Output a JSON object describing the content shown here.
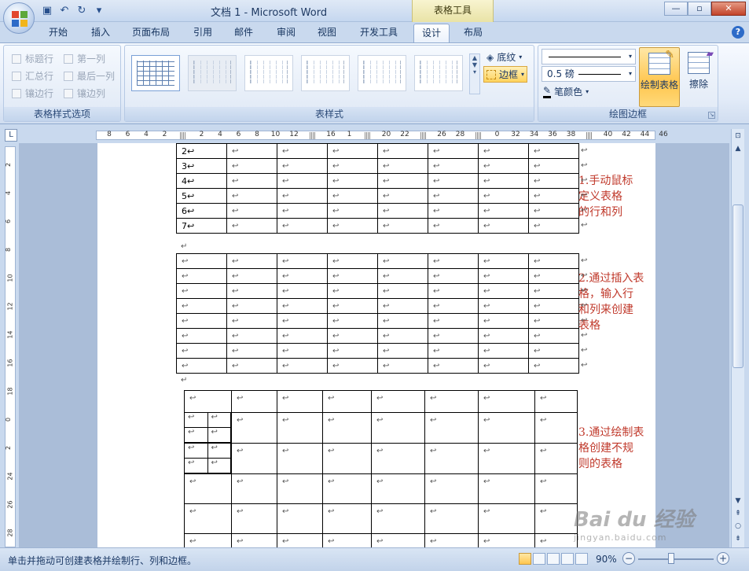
{
  "window": {
    "title": "文档 1 - Microsoft Word",
    "context_tab_title": "表格工具",
    "min": "—",
    "restore": "▫",
    "close": "✕"
  },
  "qat": {
    "save": "save-icon",
    "undo": "↶",
    "redo": "↻",
    "customize": "▾"
  },
  "tabs": [
    {
      "label": "开始"
    },
    {
      "label": "插入"
    },
    {
      "label": "页面布局"
    },
    {
      "label": "引用"
    },
    {
      "label": "邮件"
    },
    {
      "label": "审阅"
    },
    {
      "label": "视图"
    },
    {
      "label": "开发工具"
    },
    {
      "label": "设计"
    },
    {
      "label": "布局"
    }
  ],
  "active_tab": "设计",
  "help": "?",
  "ribbon": {
    "style_options": {
      "label": "表格样式选项",
      "options": [
        "标题行",
        "第一列",
        "汇总行",
        "最后一列",
        "镶边行",
        "镶边列"
      ]
    },
    "table_styles": {
      "label": "表样式",
      "shading": "底纹",
      "borders": "边框"
    },
    "draw_borders": {
      "label": "绘图边框",
      "line_weight": "0.5 磅",
      "pen_color": "笔颜色",
      "draw_table": "绘制表格",
      "eraser": "擦除"
    }
  },
  "ruler": {
    "h_ticks": [
      "8",
      "6",
      "4",
      "2",
      "",
      "2",
      "4",
      "6",
      "8",
      "10",
      "12",
      "",
      "16",
      "1",
      "",
      "20",
      "22",
      "",
      "26",
      "28",
      "",
      "0",
      "32",
      "34",
      "36",
      "38",
      "",
      "40",
      "42",
      "44",
      "46"
    ],
    "v_ticks": [
      "2",
      "4",
      "6",
      "8",
      "10",
      "12",
      "14",
      "16",
      "18",
      "0",
      "2",
      "24",
      "26",
      "28"
    ]
  },
  "document": {
    "table1_rows": [
      "2",
      "3",
      "4",
      "5",
      "6",
      "7"
    ],
    "note1": "1.手动鼠标\n定义表格\n的行和列",
    "note2": "2.通过插入表\n格，输入行\n和列来创建\n表格",
    "note3": "3.通过绘制表\n格创建不规\n则的表格",
    "para_mark": "↵",
    "cell_mark": "↩"
  },
  "status": {
    "text": "单击并拖动可创建表格并绘制行、列和边框。",
    "zoom": "90%",
    "zoom_minus": "−",
    "zoom_plus": "+"
  },
  "watermark": {
    "logo": "Bai du 经验",
    "url": "jingyan.baidu.com"
  }
}
